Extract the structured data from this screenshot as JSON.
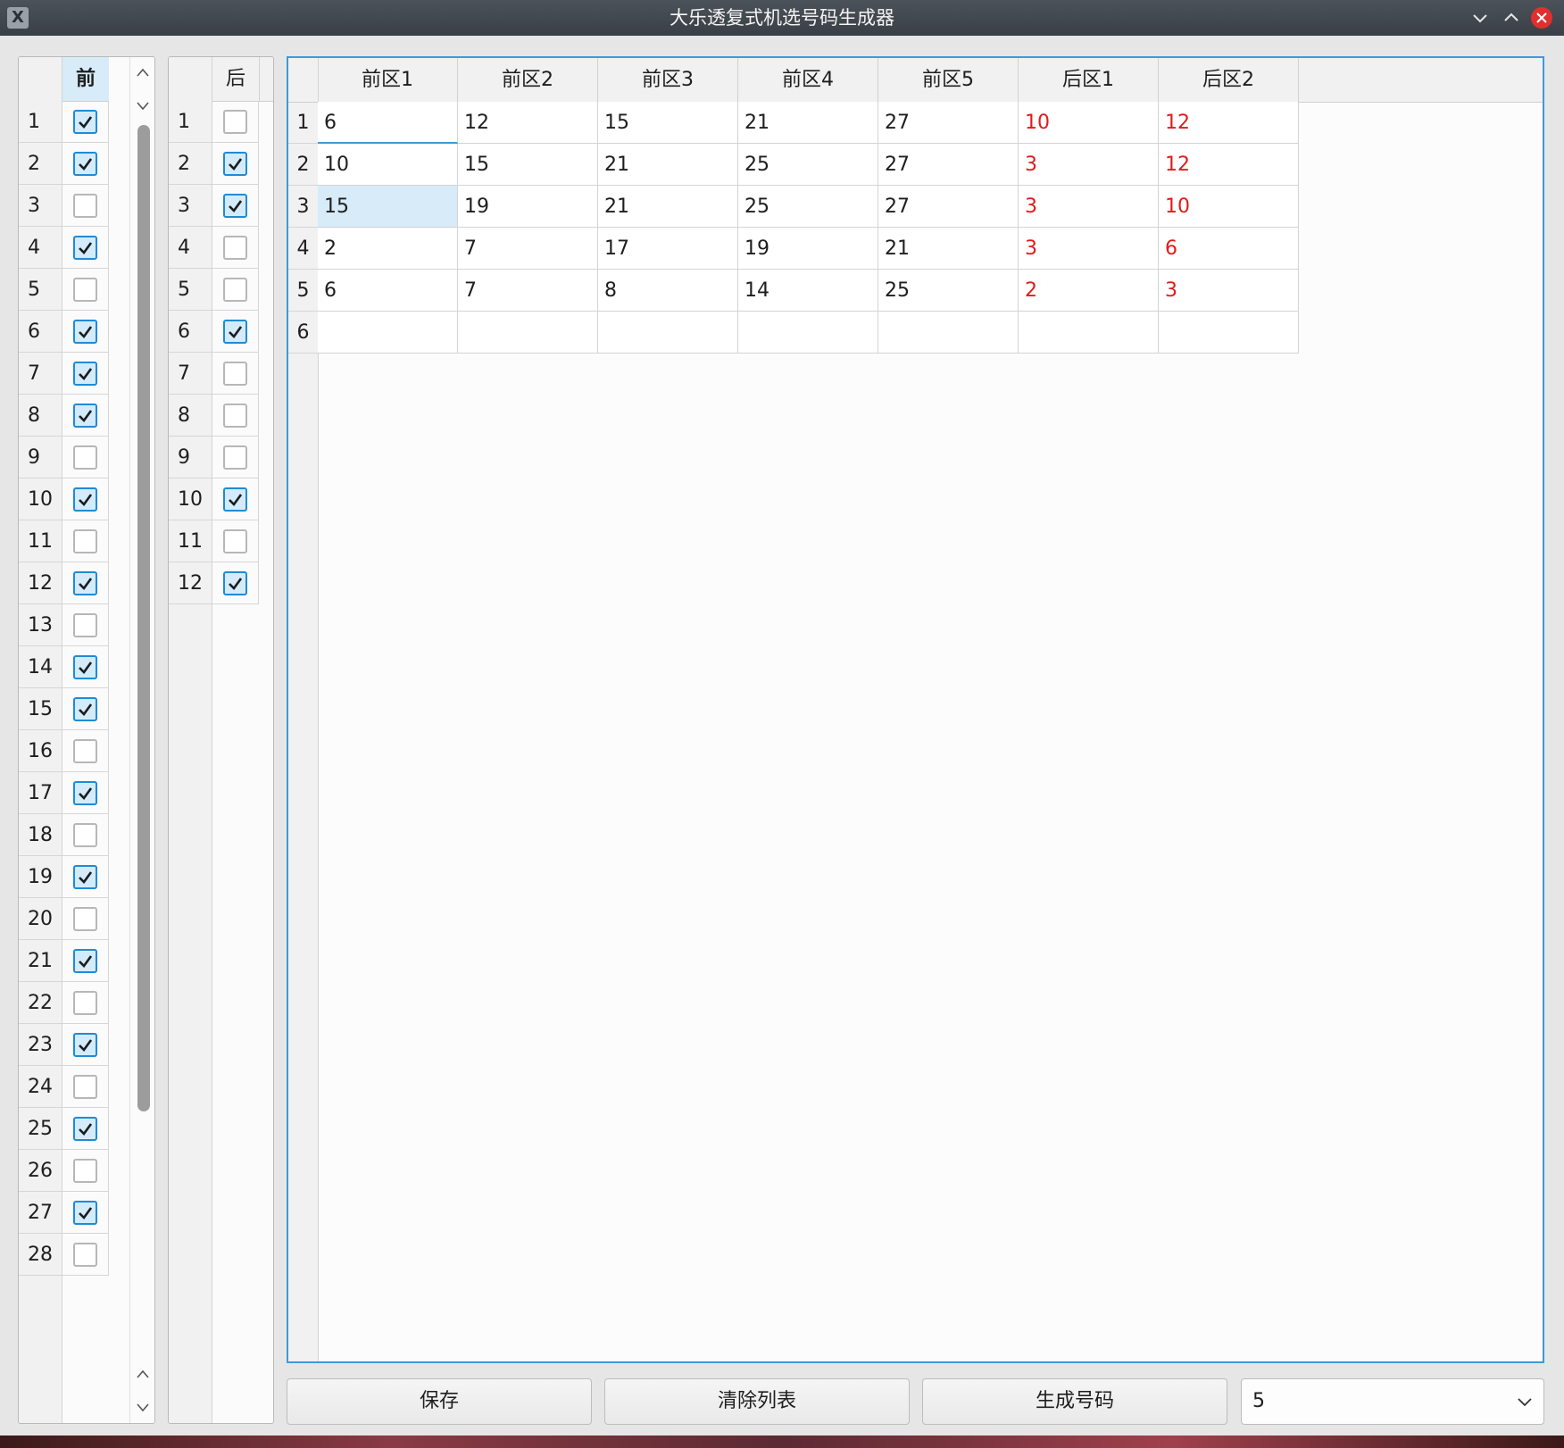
{
  "window": {
    "title": "大乐透复式机选号码生成器",
    "icon": "x-app-icon",
    "icon_glyph": "X"
  },
  "front_table": {
    "header": "前",
    "rows": [
      {
        "num": "1",
        "checked": true
      },
      {
        "num": "2",
        "checked": true
      },
      {
        "num": "3",
        "checked": false
      },
      {
        "num": "4",
        "checked": true
      },
      {
        "num": "5",
        "checked": false
      },
      {
        "num": "6",
        "checked": true
      },
      {
        "num": "7",
        "checked": true
      },
      {
        "num": "8",
        "checked": true
      },
      {
        "num": "9",
        "checked": false
      },
      {
        "num": "10",
        "checked": true
      },
      {
        "num": "11",
        "checked": false
      },
      {
        "num": "12",
        "checked": true
      },
      {
        "num": "13",
        "checked": false
      },
      {
        "num": "14",
        "checked": true
      },
      {
        "num": "15",
        "checked": true
      },
      {
        "num": "16",
        "checked": false
      },
      {
        "num": "17",
        "checked": true
      },
      {
        "num": "18",
        "checked": false
      },
      {
        "num": "19",
        "checked": true
      },
      {
        "num": "20",
        "checked": false
      },
      {
        "num": "21",
        "checked": true
      },
      {
        "num": "22",
        "checked": false
      },
      {
        "num": "23",
        "checked": true
      },
      {
        "num": "24",
        "checked": false
      },
      {
        "num": "25",
        "checked": true
      },
      {
        "num": "26",
        "checked": false
      },
      {
        "num": "27",
        "checked": true
      },
      {
        "num": "28",
        "checked": false
      }
    ]
  },
  "back_table": {
    "header": "后",
    "rows": [
      {
        "num": "1",
        "checked": false
      },
      {
        "num": "2",
        "checked": true
      },
      {
        "num": "3",
        "checked": true
      },
      {
        "num": "4",
        "checked": false
      },
      {
        "num": "5",
        "checked": false
      },
      {
        "num": "6",
        "checked": true
      },
      {
        "num": "7",
        "checked": false
      },
      {
        "num": "8",
        "checked": false
      },
      {
        "num": "9",
        "checked": false
      },
      {
        "num": "10",
        "checked": true
      },
      {
        "num": "11",
        "checked": false
      },
      {
        "num": "12",
        "checked": true
      }
    ]
  },
  "results": {
    "columns": [
      "前区1",
      "前区2",
      "前区3",
      "前区4",
      "前区5",
      "后区1",
      "后区2"
    ],
    "back_zone_color": "#e21a1a",
    "rows": [
      {
        "num": "1",
        "cells": [
          "6",
          "12",
          "15",
          "21",
          "27",
          "10",
          "12"
        ]
      },
      {
        "num": "2",
        "cells": [
          "10",
          "15",
          "21",
          "25",
          "27",
          "3",
          "12"
        ]
      },
      {
        "num": "3",
        "cells": [
          "15",
          "19",
          "21",
          "25",
          "27",
          "3",
          "10"
        ]
      },
      {
        "num": "4",
        "cells": [
          "2",
          "7",
          "17",
          "19",
          "21",
          "3",
          "6"
        ]
      },
      {
        "num": "5",
        "cells": [
          "6",
          "7",
          "8",
          "14",
          "25",
          "2",
          "3"
        ]
      },
      {
        "num": "6",
        "cells": [
          "",
          "",
          "",
          "",
          "",
          "",
          ""
        ]
      }
    ]
  },
  "buttons": {
    "save": "保存",
    "clear": "清除列表",
    "generate": "生成号码"
  },
  "count_select": {
    "value": "5"
  }
}
